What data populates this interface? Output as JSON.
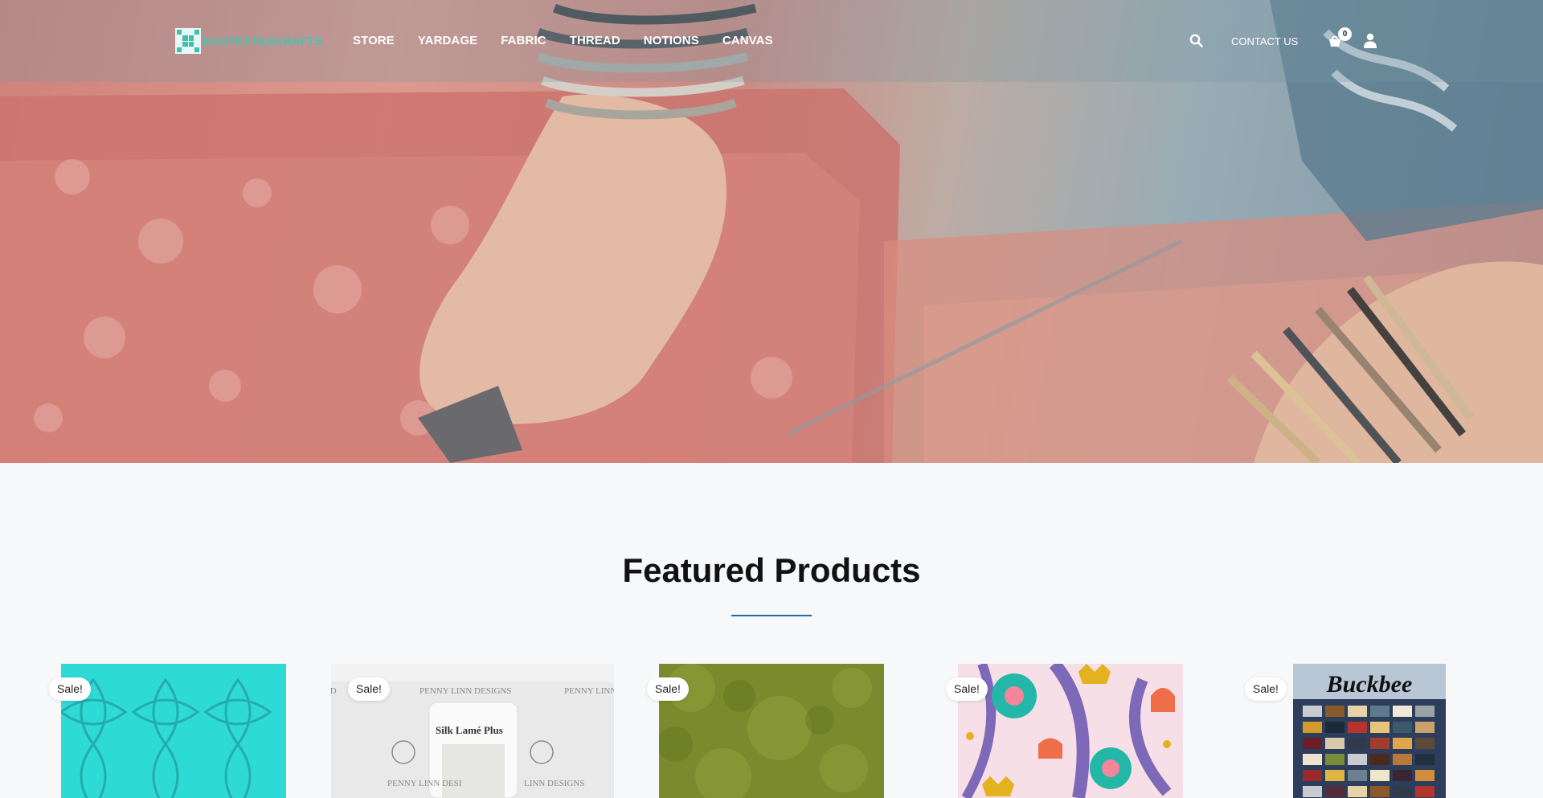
{
  "header": {
    "logo_text": "ECOTEXTILECRAFTS",
    "nav": [
      "STORE",
      "YARDAGE",
      "FABRIC",
      "THREAD",
      "NOTIONS",
      "CANVAS"
    ],
    "contact_label": "CONTACT US",
    "cart_count": "0",
    "icons": [
      "search-icon",
      "cart-icon",
      "user-icon"
    ]
  },
  "featured": {
    "title": "Featured Products",
    "accent_color": "#1a6fa8"
  },
  "products": [
    {
      "badge": "Sale!",
      "image": "teal-holographic-fabric"
    },
    {
      "badge": "Sale!",
      "image": "penny-linn-silk-lame-plus-thread-card",
      "image_texts": [
        "PENNY LINN DESIGNS",
        "Silk Lamé Plus"
      ]
    },
    {
      "badge": "Sale!",
      "image": "olive-green-mottled-fabric"
    },
    {
      "badge": "Sale!",
      "image": "floral-pattern-fabric"
    },
    {
      "badge": "Sale!",
      "image": "buckbee-quilt-pattern",
      "image_texts": [
        "Buckbee"
      ]
    }
  ]
}
